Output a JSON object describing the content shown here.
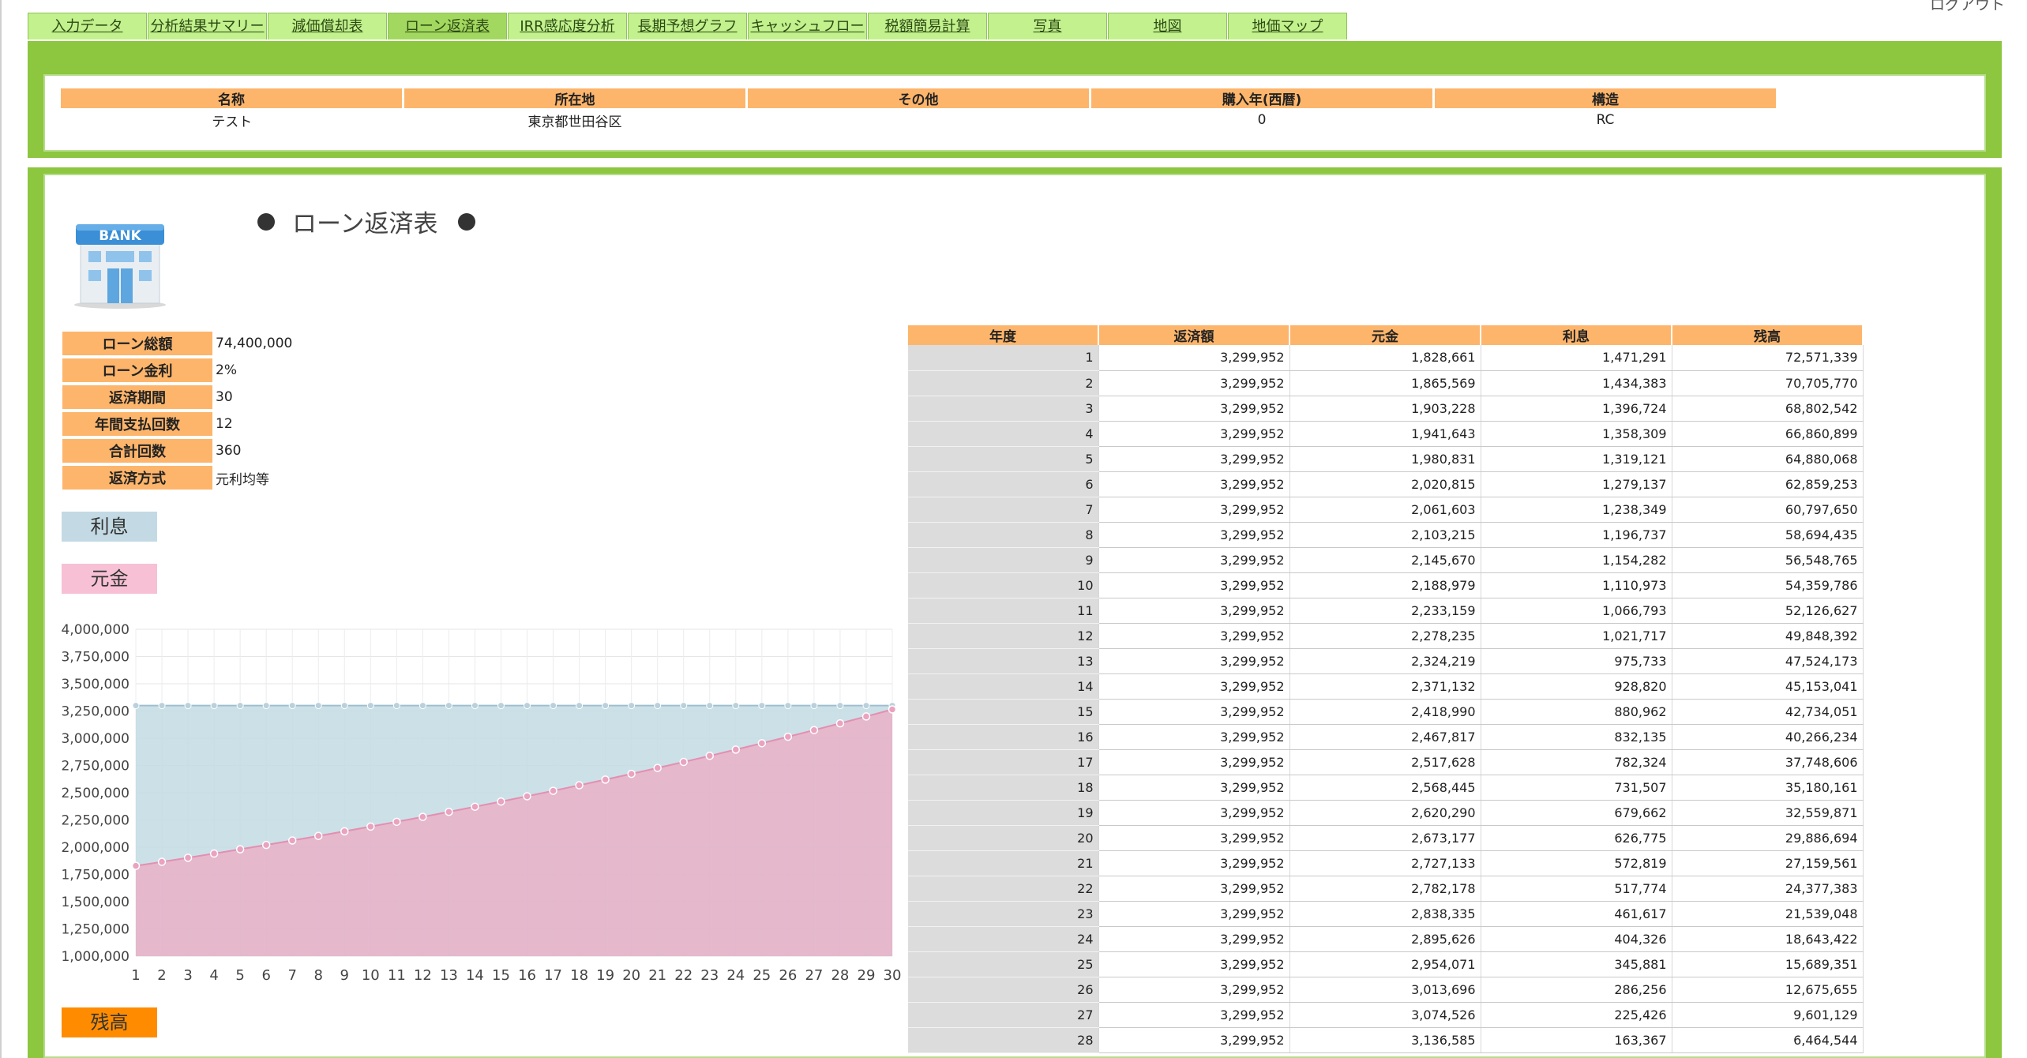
{
  "top_right_text": "ログアウト",
  "tabs": [
    {
      "label": "入力データ"
    },
    {
      "label": "分析結果サマリー"
    },
    {
      "label": "減価償却表"
    },
    {
      "label": "ローン返済表"
    },
    {
      "label": "IRR感応度分析"
    },
    {
      "label": "長期予想グラフ"
    },
    {
      "label": "キャッシュフロー"
    },
    {
      "label": "税額簡易計算"
    },
    {
      "label": "写真"
    },
    {
      "label": "地図"
    },
    {
      "label": "地価マップ"
    }
  ],
  "active_tab": "ローン返済表",
  "property": {
    "headers": [
      "名称",
      "所在地",
      "その他",
      "購入年(西暦)",
      "構造"
    ],
    "values": [
      "テスト",
      "東京都世田谷区",
      "",
      "0",
      "RC"
    ]
  },
  "title": "ローン返済表",
  "bank_icon_label": "BANK",
  "loan_info": [
    {
      "label": "ローン総額",
      "value": "74,400,000"
    },
    {
      "label": "ローン金利",
      "value": "2%"
    },
    {
      "label": "返済期間",
      "value": "30"
    },
    {
      "label": "年間支払回数",
      "value": "12"
    },
    {
      "label": "合計回数",
      "value": "360"
    },
    {
      "label": "返済方式",
      "value": "元利均等"
    }
  ],
  "legend": {
    "interest": "利息",
    "principal": "元金",
    "balance": "残高"
  },
  "colors": {
    "interest_fill": "#c3dae4",
    "principal_fill": "#e6b5ca",
    "balance_fill": "#ff8c00",
    "header_orange": "#fdb56b",
    "panel_green": "#8dc63f",
    "tab_green": "#c2f18e"
  },
  "chart_data": {
    "type": "area",
    "x": [
      1,
      2,
      3,
      4,
      5,
      6,
      7,
      8,
      9,
      10,
      11,
      12,
      13,
      14,
      15,
      16,
      17,
      18,
      19,
      20,
      21,
      22,
      23,
      24,
      25,
      26,
      27,
      28,
      29,
      30
    ],
    "ylim": [
      1000000,
      4000000
    ],
    "yticks": [
      "1,000,000",
      "1,250,000",
      "1,500,000",
      "1,750,000",
      "2,000,000",
      "2,250,000",
      "2,500,000",
      "2,750,000",
      "3,000,000",
      "3,250,000",
      "3,500,000",
      "3,750,000",
      "4,000,000"
    ],
    "series": [
      {
        "name": "利息",
        "values": [
          3299952,
          3299952,
          3299952,
          3299952,
          3299952,
          3299952,
          3299952,
          3299952,
          3299952,
          3299952,
          3299952,
          3299952,
          3299952,
          3299952,
          3299952,
          3299952,
          3299952,
          3299952,
          3299952,
          3299952,
          3299952,
          3299952,
          3299952,
          3299952,
          3299952,
          3299952,
          3299952,
          3299952,
          3299952,
          3299952
        ]
      },
      {
        "name": "元金",
        "values": [
          1828661,
          1865569,
          1903228,
          1941643,
          1980831,
          2020815,
          2061603,
          2103215,
          2145670,
          2188979,
          2233159,
          2278235,
          2324219,
          2371132,
          2418990,
          2467817,
          2517628,
          2568445,
          2620290,
          2673177,
          2727133,
          2782178,
          2838335,
          2895626,
          2954071,
          3013696,
          3074526,
          3136585,
          3199896,
          3264483
        ]
      }
    ],
    "grid": true
  },
  "schedule": {
    "headers": [
      "年度",
      "返済額",
      "元金",
      "利息",
      "残高"
    ],
    "rows": [
      [
        "1",
        "3,299,952",
        "1,828,661",
        "1,471,291",
        "72,571,339"
      ],
      [
        "2",
        "3,299,952",
        "1,865,569",
        "1,434,383",
        "70,705,770"
      ],
      [
        "3",
        "3,299,952",
        "1,903,228",
        "1,396,724",
        "68,802,542"
      ],
      [
        "4",
        "3,299,952",
        "1,941,643",
        "1,358,309",
        "66,860,899"
      ],
      [
        "5",
        "3,299,952",
        "1,980,831",
        "1,319,121",
        "64,880,068"
      ],
      [
        "6",
        "3,299,952",
        "2,020,815",
        "1,279,137",
        "62,859,253"
      ],
      [
        "7",
        "3,299,952",
        "2,061,603",
        "1,238,349",
        "60,797,650"
      ],
      [
        "8",
        "3,299,952",
        "2,103,215",
        "1,196,737",
        "58,694,435"
      ],
      [
        "9",
        "3,299,952",
        "2,145,670",
        "1,154,282",
        "56,548,765"
      ],
      [
        "10",
        "3,299,952",
        "2,188,979",
        "1,110,973",
        "54,359,786"
      ],
      [
        "11",
        "3,299,952",
        "2,233,159",
        "1,066,793",
        "52,126,627"
      ],
      [
        "12",
        "3,299,952",
        "2,278,235",
        "1,021,717",
        "49,848,392"
      ],
      [
        "13",
        "3,299,952",
        "2,324,219",
        "975,733",
        "47,524,173"
      ],
      [
        "14",
        "3,299,952",
        "2,371,132",
        "928,820",
        "45,153,041"
      ],
      [
        "15",
        "3,299,952",
        "2,418,990",
        "880,962",
        "42,734,051"
      ],
      [
        "16",
        "3,299,952",
        "2,467,817",
        "832,135",
        "40,266,234"
      ],
      [
        "17",
        "3,299,952",
        "2,517,628",
        "782,324",
        "37,748,606"
      ],
      [
        "18",
        "3,299,952",
        "2,568,445",
        "731,507",
        "35,180,161"
      ],
      [
        "19",
        "3,299,952",
        "2,620,290",
        "679,662",
        "32,559,871"
      ],
      [
        "20",
        "3,299,952",
        "2,673,177",
        "626,775",
        "29,886,694"
      ],
      [
        "21",
        "3,299,952",
        "2,727,133",
        "572,819",
        "27,159,561"
      ],
      [
        "22",
        "3,299,952",
        "2,782,178",
        "517,774",
        "24,377,383"
      ],
      [
        "23",
        "3,299,952",
        "2,838,335",
        "461,617",
        "21,539,048"
      ],
      [
        "24",
        "3,299,952",
        "2,895,626",
        "404,326",
        "18,643,422"
      ],
      [
        "25",
        "3,299,952",
        "2,954,071",
        "345,881",
        "15,689,351"
      ],
      [
        "26",
        "3,299,952",
        "3,013,696",
        "286,256",
        "12,675,655"
      ],
      [
        "27",
        "3,299,952",
        "3,074,526",
        "225,426",
        "9,601,129"
      ],
      [
        "28",
        "3,299,952",
        "3,136,585",
        "163,367",
        "6,464,544"
      ]
    ]
  }
}
